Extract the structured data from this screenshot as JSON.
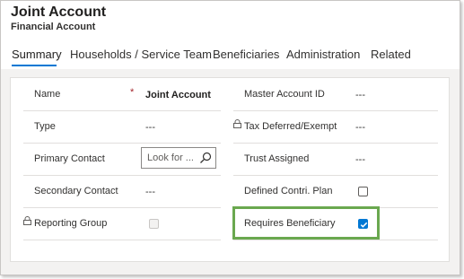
{
  "header": {
    "title": "Joint Account",
    "subtitle": "Financial Account"
  },
  "tabs": [
    {
      "label": "Summary",
      "active": true
    },
    {
      "label": "Households / Service Team",
      "active": false
    },
    {
      "label": "Beneficiaries",
      "active": false
    },
    {
      "label": "Administration",
      "active": false
    },
    {
      "label": "Related",
      "active": false
    }
  ],
  "fields_left": [
    {
      "label": "Name",
      "required_mark": "*",
      "value": "Joint Account"
    },
    {
      "label": "Type",
      "value": "---"
    },
    {
      "label": "Primary Contact",
      "placeholder": "Look for ..."
    },
    {
      "label": "Secondary Contact",
      "value": "---"
    },
    {
      "label": "Reporting Group",
      "locked": true,
      "checked": false,
      "disabled": true
    }
  ],
  "fields_right": [
    {
      "label": "Master Account ID",
      "value": "---"
    },
    {
      "label": "Tax Deferred/Exempt",
      "locked": true,
      "value": "---"
    },
    {
      "label": "Trust Assigned",
      "value": "---"
    },
    {
      "label": "Defined Contri. Plan",
      "checked": false
    },
    {
      "label": "Requires Beneficiary",
      "checked": true,
      "highlighted": true
    }
  ],
  "colors": {
    "accent": "#0078d4",
    "highlight_border": "#6aa84f",
    "required": "#a4262c"
  }
}
